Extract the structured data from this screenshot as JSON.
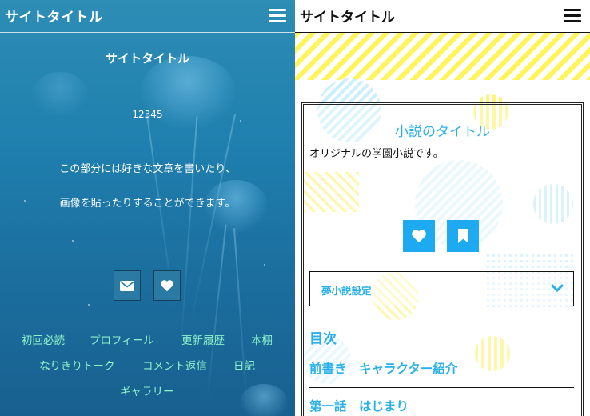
{
  "left": {
    "site_title": "サイトタイトル",
    "hero_title": "サイトタイトル",
    "counter": "12345",
    "description_lines": [
      "この部分には好きな文章を書いたり、",
      "画像を貼ったりすることができます。"
    ],
    "buttons": [
      "mail-icon",
      "heart-icon"
    ],
    "nav": [
      "初回必読",
      "プロフィール",
      "更新履歴",
      "本棚",
      "なりきりトーク",
      "コメント返信",
      "日記",
      "ギャラリー"
    ],
    "colors": {
      "nav_text": "#8cf0c8",
      "background": "#1f7fae"
    }
  },
  "right": {
    "site_title": "サイトタイトル",
    "novel_title": "小説のタイトル",
    "novel_description": "オリジナルの学園小説です。",
    "buttons": [
      "heart-icon",
      "bookmark-icon"
    ],
    "dropdown_label": "夢小説設定",
    "toc_heading": "目次",
    "toc_items": [
      "前書き　キャラクター紹介",
      "第一話　はじまり"
    ],
    "colors": {
      "accent": "#2ab0e8",
      "stripe": "#fff45a",
      "button": "#1eaaf0"
    }
  }
}
